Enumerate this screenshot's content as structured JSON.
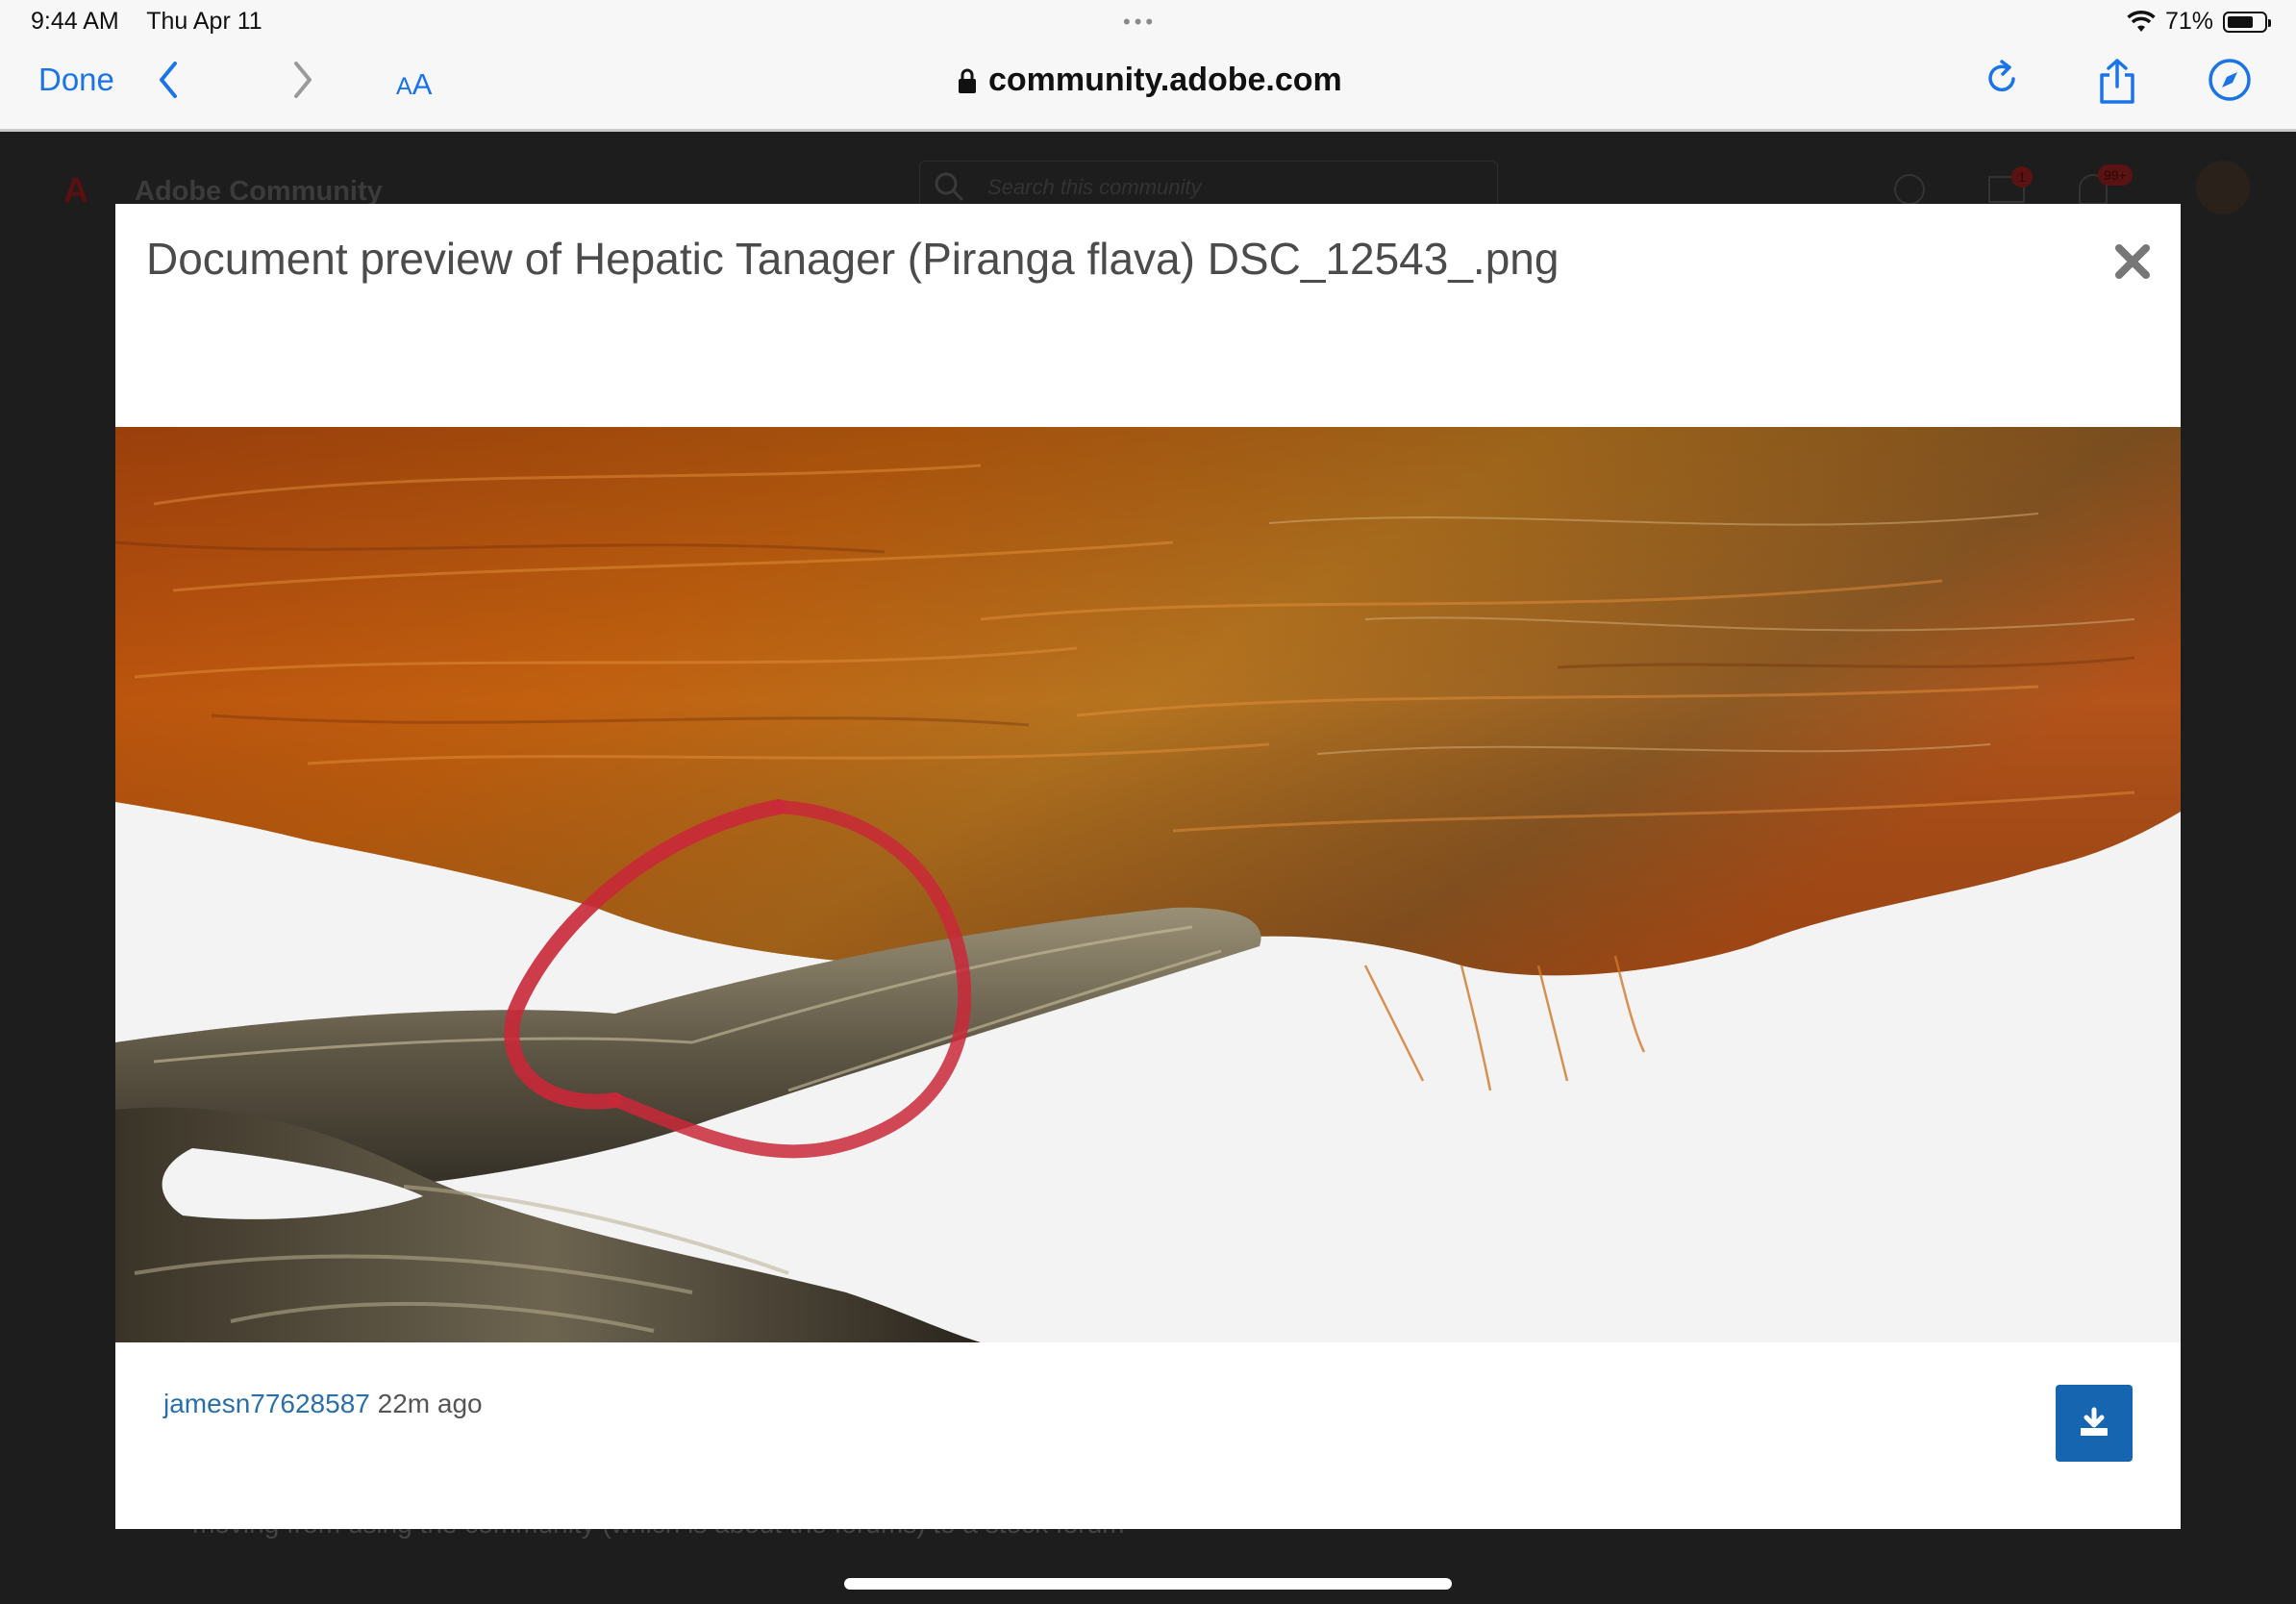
{
  "status_bar": {
    "time": "9:44 AM",
    "date": "Thu Apr 11",
    "battery": "71%",
    "battery_level": 0.71
  },
  "browser": {
    "done_label": "Done",
    "text_size_small": "A",
    "text_size_large": "A",
    "url": "community.adobe.com",
    "accent_color": "#1a74e8"
  },
  "background_page": {
    "site_title": "Adobe Community",
    "search_placeholder": "Search this community",
    "mail_badge": "1",
    "notification_badge": "99+",
    "body_text": "moving from using the community (which is about the forums) to a stock forum"
  },
  "modal": {
    "title": "Document preview of Hepatic Tanager (Piranga flava) DSC_12543_.png",
    "author": "jamesn77628587",
    "timestamp": "22m ago",
    "download_color": "#1565b0"
  }
}
